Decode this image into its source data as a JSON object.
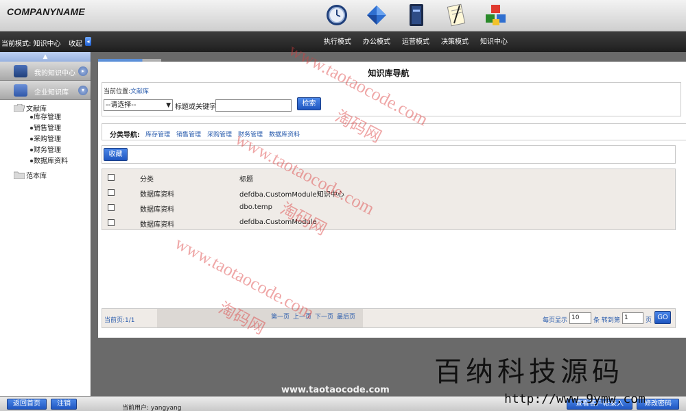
{
  "header": {
    "company_name": "COMPANYNAME",
    "mode_icons": [
      "clock-icon",
      "diamond-icon",
      "book-icon",
      "notepad-icon",
      "cubes-icon"
    ]
  },
  "modebar": {
    "current_mode": "当前模式: 知识中心",
    "collapse": "收起",
    "modes": [
      "执行模式",
      "办公模式",
      "运营模式",
      "决策模式",
      "知识中心"
    ]
  },
  "sidebar": {
    "sections": [
      {
        "label": "我的知识中心"
      },
      {
        "label": "企业知识库"
      }
    ],
    "tree": {
      "root1": "文献库",
      "children": [
        "库存管理",
        "销售管理",
        "采购管理",
        "财务管理",
        "数据库资料"
      ],
      "root2": "范本库"
    }
  },
  "main": {
    "title": "知识库导航",
    "breadcrumb_label": "当前位置:",
    "breadcrumb_link": "文献库",
    "select_value": "--请选择--",
    "keyword_label": "标题或关键字:",
    "keyword_value": "",
    "search_button": "检索",
    "category_label": "分类导航:",
    "categories": [
      "库存管理",
      "销售管理",
      "采购管理",
      "财务管理",
      "数据库资料"
    ],
    "favorite_button": "收藏",
    "table": {
      "headers": [
        "分类",
        "标题"
      ],
      "rows": [
        {
          "category": "数据库资料",
          "title": "defdba.CustomModule知识中心"
        },
        {
          "category": "数据库资料",
          "title": "dbo.temp"
        },
        {
          "category": "数据库资料",
          "title": "defdba.CustomModule"
        }
      ]
    },
    "pager": {
      "current": "当前页:1/1",
      "first": "第一页",
      "prev": "上一页",
      "next": "下一页",
      "last": "最后页",
      "per_page_label": "每页显示",
      "per_page_value": "10",
      "goto_label": "条 转到第",
      "goto_value": "1",
      "page_suffix": "页",
      "go_button": "GO"
    }
  },
  "bottombar": {
    "home_button": "返回首页",
    "logout_button": "注销",
    "current_user": "当前用户: yangyang",
    "right_button_1": "查看客户帐录入",
    "right_button_2": "修改密码"
  },
  "watermarks": {
    "taotao": "www.taotaocode.com",
    "taotao_cn": "淘码网",
    "site": "www.taotaocode.com",
    "brand_cn": "百纳科技源码",
    "brand_url": "http://www.9ymw.com"
  },
  "colors": {
    "accent_blue": "#2a5cad",
    "button_blue": "#1f56c0",
    "watermark_red": "#dc3c3c"
  }
}
